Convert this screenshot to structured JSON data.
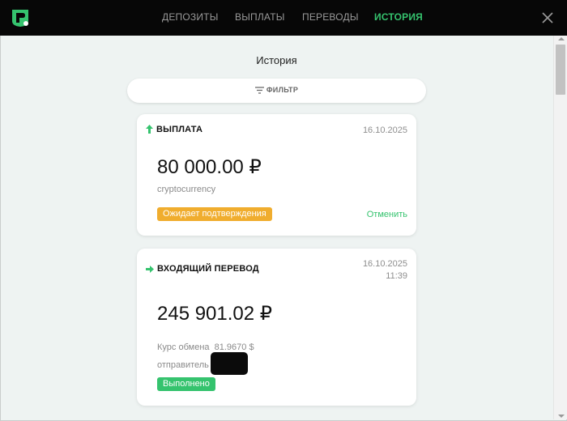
{
  "colors": {
    "accent": "#35c36e",
    "pending": "#f0ad2e",
    "topbar": "#070707",
    "background": "#eef3f2"
  },
  "nav": {
    "tabs": [
      {
        "label": "ДЕПОЗИТЫ"
      },
      {
        "label": "ВЫПЛАТЫ"
      },
      {
        "label": "ПЕРЕВОДЫ"
      },
      {
        "label": "ИСТОРИЯ",
        "active": true
      }
    ],
    "close_icon": "close-icon",
    "logo_icon": "brand-logo"
  },
  "main": {
    "title": "История",
    "filter_label": "ФИЛЬТР",
    "filter_icon": "filter-icon"
  },
  "transactions": [
    {
      "type_icon": "arrow-up-icon",
      "type": "ВЫПЛАТА",
      "date": "16.10.2025",
      "amount": "80 000.00 ₽",
      "method": "cryptocurrency",
      "status": "Ожидает подтверждения",
      "action": "Отменить"
    },
    {
      "type_icon": "arrow-right-icon",
      "type": "ВХОДЯЩИЙ ПЕРЕВОД",
      "date": "16.10.2025",
      "time": "11:39",
      "amount": "245 901.02 ₽",
      "rate_label": "Курс обмена",
      "rate_value": "81.9670 $",
      "sender_label": "отправитель",
      "status": "Выполнено"
    }
  ]
}
